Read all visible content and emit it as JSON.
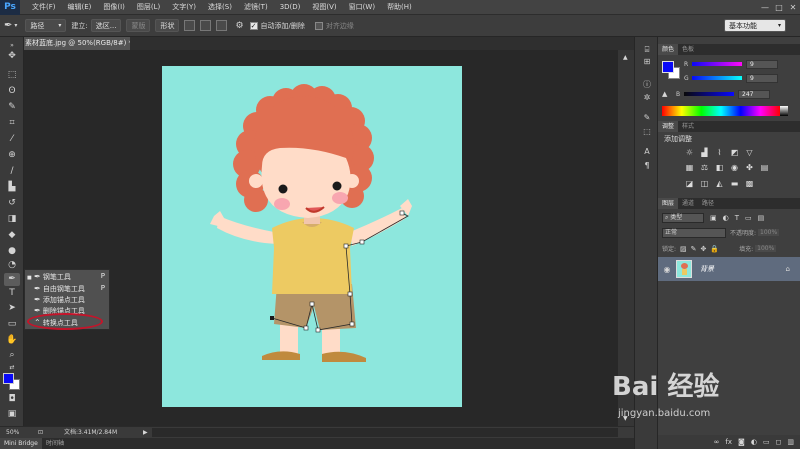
{
  "app": {
    "logo": "Ps"
  },
  "menu": [
    "文件(F)",
    "编辑(E)",
    "图像(I)",
    "图层(L)",
    "文字(Y)",
    "选择(S)",
    "滤镜(T)",
    "3D(D)",
    "视图(V)",
    "窗口(W)",
    "帮助(H)"
  ],
  "window_controls": [
    "—",
    "□",
    "✕"
  ],
  "options": {
    "mode": "路径",
    "build_label": "建立:",
    "selection_btn": "选区...",
    "mask_btn": "蒙版",
    "shape_btn": "形状",
    "auto_add_delete": "自动添加/删除",
    "align_edges": "对齐边缘",
    "workspace": "基本功能"
  },
  "document": {
    "tab_title": "素材蓝底.jpg @ 50%(RGB/8#) *"
  },
  "status": {
    "zoom": "50%",
    "doc_size": "文档:3.41M/2.84M"
  },
  "bottom_tabs": [
    "Mini Bridge",
    "时间轴"
  ],
  "flyout": {
    "items": [
      {
        "label": "钢笔工具",
        "shortcut": "P"
      },
      {
        "label": "自由钢笔工具",
        "shortcut": "P"
      },
      {
        "label": "添加锚点工具",
        "shortcut": ""
      },
      {
        "label": "删除锚点工具",
        "shortcut": ""
      },
      {
        "label": "转换点工具",
        "shortcut": ""
      }
    ]
  },
  "color_panel": {
    "tabs": [
      "颜色",
      "色板"
    ],
    "r_label": "R",
    "r": "9",
    "g_label": "G",
    "g": "9",
    "b_label": "B",
    "b": "247",
    "foreground": "#0909f7"
  },
  "adjust_panel": {
    "tabs": [
      "调整",
      "样式"
    ],
    "title": "添加调整"
  },
  "layers_panel": {
    "tabs": [
      "图层",
      "通道",
      "路径"
    ],
    "filter": "类型",
    "blend_mode": "正常",
    "opacity_label": "不透明度:",
    "opacity": "100%",
    "lock_label": "锁定:",
    "fill_label": "填充:",
    "fill": "100%",
    "layer_name": "背景"
  },
  "watermark": {
    "text": "Bai 经验",
    "url": "jingyan.baidu.com"
  },
  "colors": {
    "canvas_bg": "#8de7dd",
    "hair": "#e06f52",
    "shirt": "#edca62",
    "shorts": "#b49468"
  }
}
